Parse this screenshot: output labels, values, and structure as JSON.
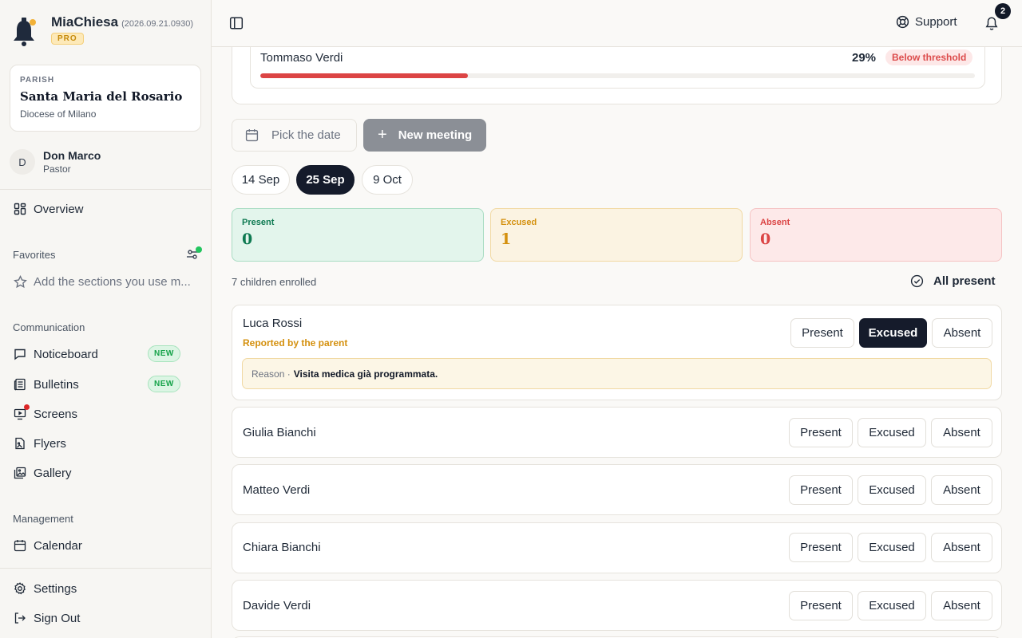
{
  "app": {
    "name": "MiaChiesa",
    "version": "(2026.09.21.0930)",
    "tier": "PRO"
  },
  "parish": {
    "label": "PARISH",
    "name": "Santa Maria del Rosario",
    "diocese": "Diocese of Milano"
  },
  "user": {
    "initial": "D",
    "name": "Don Marco",
    "role": "Pastor"
  },
  "nav": {
    "overview": "Overview",
    "favorites_title": "Favorites",
    "favorites_placeholder": "Add the sections you use m...",
    "communication_title": "Communication",
    "noticeboard": "Noticeboard",
    "bulletins": "Bulletins",
    "screens": "Screens",
    "flyers": "Flyers",
    "gallery": "Gallery",
    "new_badge": "NEW",
    "management_title": "Management",
    "calendar": "Calendar",
    "settings": "Settings",
    "sign_out": "Sign Out"
  },
  "topbar": {
    "support": "Support",
    "notifications_count": "2"
  },
  "threshold": {
    "name": "Tommaso Verdi",
    "percent_label": "29%",
    "percent": 29,
    "badge": "Below threshold"
  },
  "actions": {
    "pick_date": "Pick the date",
    "new_meeting": "New meeting"
  },
  "dates": [
    "14 Sep",
    "25 Sep",
    "9 Oct"
  ],
  "selected_date": "25 Sep",
  "stats": {
    "present_label": "Present",
    "present_value": "0",
    "excused_label": "Excused",
    "excused_value": "1",
    "absent_label": "Absent",
    "absent_value": "0"
  },
  "roster": {
    "enrolled": "7 children enrolled",
    "all_present": "All present",
    "btn_present": "Present",
    "btn_excused": "Excused",
    "btn_absent": "Absent",
    "children": [
      {
        "name": "Luca Rossi",
        "status": "Excused",
        "reported": "Reported by the parent",
        "reason_label": "Reason ·",
        "reason": "Visita medica già programmata."
      },
      {
        "name": "Giulia Bianchi",
        "status": ""
      },
      {
        "name": "Matteo Verdi",
        "status": ""
      },
      {
        "name": "Chiara Bianchi",
        "status": ""
      },
      {
        "name": "Davide Verdi",
        "status": ""
      }
    ]
  },
  "colors": {
    "accent_dark": "#151b2b",
    "present": "#0f7a52",
    "excused": "#d4900e",
    "absent": "#db4545",
    "new_badge": "#16a34a"
  }
}
